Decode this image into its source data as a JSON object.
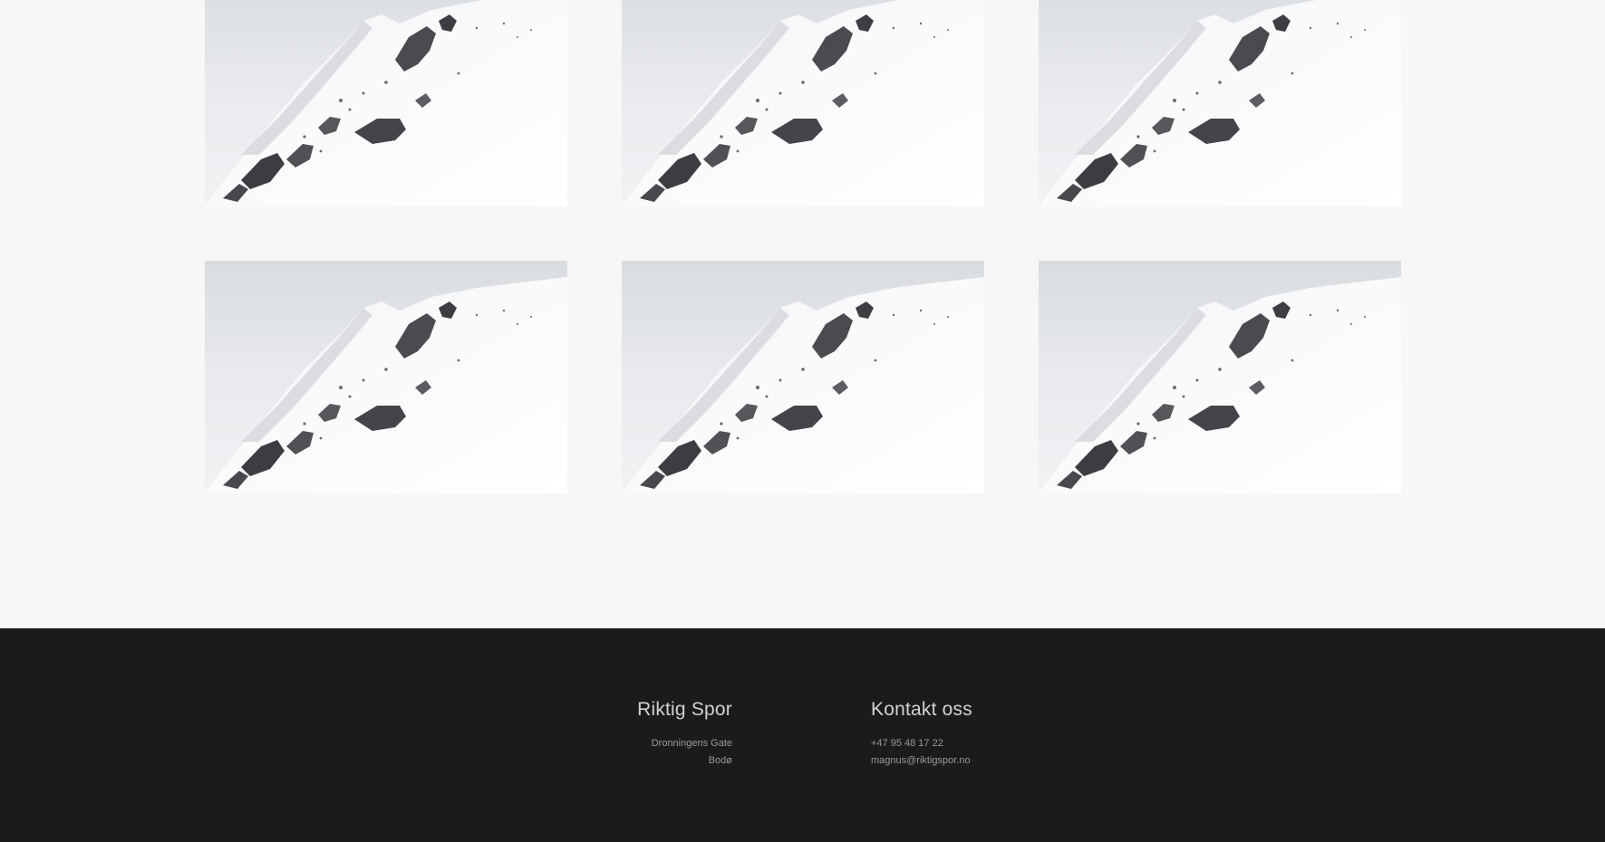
{
  "gallery": {
    "images": [
      {
        "name": "snowy-mountain-photo"
      },
      {
        "name": "snowy-mountain-photo"
      },
      {
        "name": "snowy-mountain-photo"
      },
      {
        "name": "snowy-mountain-photo"
      },
      {
        "name": "snowy-mountain-photo"
      },
      {
        "name": "snowy-mountain-photo"
      }
    ]
  },
  "footer": {
    "left": {
      "title": "Riktig Spor",
      "address_line1": "Dronningens Gate",
      "address_line2": "Bodø"
    },
    "right": {
      "title": "Kontakt oss",
      "phone": "+47 95 48 17 22",
      "email": "magnus@riktigspor.no"
    }
  },
  "colors": {
    "page_background": "#f7f7f7",
    "footer_background": "#1b1b1b",
    "footer_title": "#d2d2d2",
    "footer_text": "#9a9a9a"
  }
}
